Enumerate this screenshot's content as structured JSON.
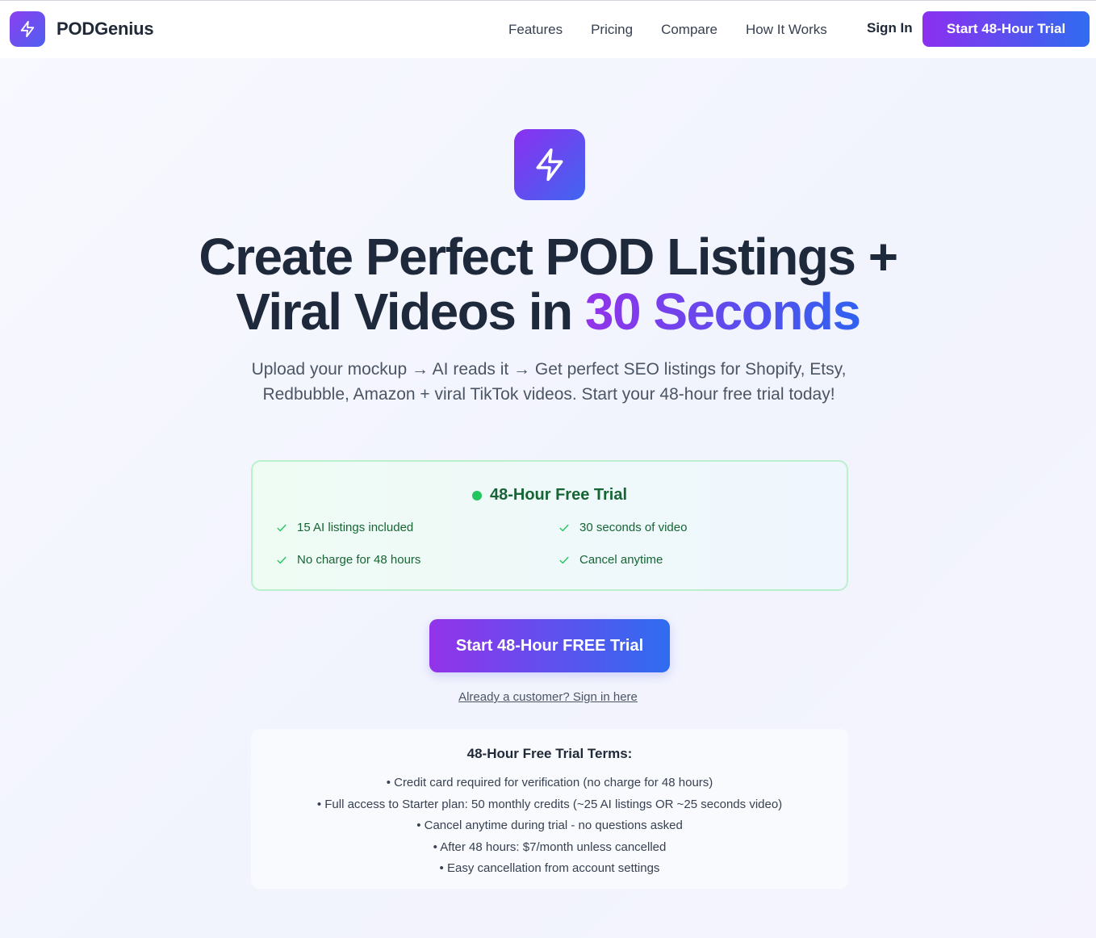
{
  "nav": {
    "brand": "PODGenius",
    "links": [
      "Features",
      "Pricing",
      "Compare",
      "How It Works"
    ],
    "sign_in": "Sign In",
    "cta": "Start 48-Hour Trial"
  },
  "hero": {
    "headline_line1": "Create Perfect POD Listings +",
    "headline_line2_prefix": "Viral Videos in ",
    "headline_accent": "30 Seconds",
    "subhead": "Upload your mockup → AI reads it → Get perfect SEO listings for Shopify, Etsy, Redbubble, Amazon + viral TikTok videos. Start your 48-hour free trial today!"
  },
  "trial": {
    "title": "48-Hour Free Trial",
    "features": [
      "15 AI listings included",
      "30 seconds of video",
      "No charge for 48 hours",
      "Cancel anytime"
    ]
  },
  "cta": {
    "main": "Start 48-Hour FREE Trial",
    "signin_link": "Already a customer? Sign in here"
  },
  "terms": {
    "title": "48-Hour Free Trial Terms:",
    "items": [
      "Credit card required for verification (no charge for 48 hours)",
      "Full access to Starter plan: 50 monthly credits (~25 AI listings OR ~25 seconds video)",
      "Cancel anytime during trial - no questions asked",
      "After 48 hours: $7/month unless cancelled",
      "Easy cancellation from account settings"
    ]
  },
  "icons": {
    "brand_logo": "lightning-bolt-icon",
    "hero_logo": "lightning-bolt-icon",
    "trial_status": "green-dot",
    "feature_check": "check-icon"
  },
  "colors": {
    "brand_gradient_start": "#9333ea",
    "brand_gradient_end": "#2f6cf0",
    "trial_green": "#166534",
    "trial_dot": "#22c55e"
  }
}
